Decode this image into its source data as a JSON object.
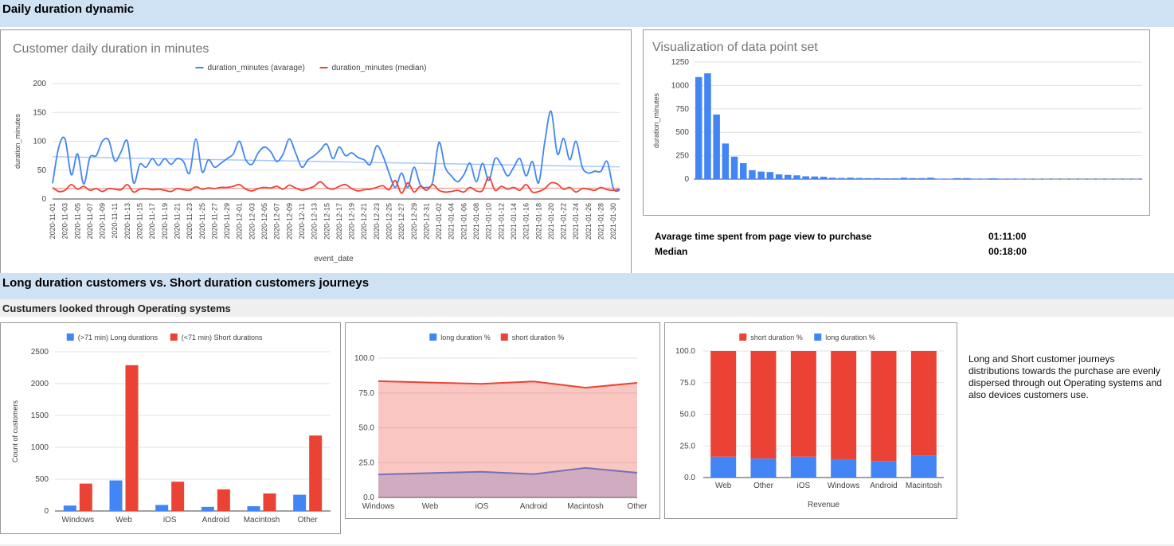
{
  "sections": {
    "daily_header": "Daily duration dynamic",
    "journeys_header": "Long duration customers vs. Short duration customers journeys",
    "os_subheader": "Custumers looked through Operating systems"
  },
  "summary": {
    "avg_label": "Avarage time spent from page view to purchase",
    "avg_value": "01:11:00",
    "median_label": "Median",
    "median_value": "00:18:00"
  },
  "note": "Long and Short customer journeys distributions towards the purchase are evenly dispersed through out Operating systems and also devices customers use.",
  "colors": {
    "blue": "#4285f4",
    "red": "#ea4335",
    "trend_blue": "#a8c7fa",
    "trend_red": "#f4a9a2",
    "grid": "#e0e0e0",
    "axis": "#444444"
  },
  "chart_data": [
    {
      "id": "daily",
      "type": "line",
      "title": "Customer daily duration in minutes",
      "xlabel": "event_date",
      "ylabel": "duration_minutes",
      "ylim": [
        0,
        200
      ],
      "yticks": [
        0,
        50,
        100,
        150,
        200
      ],
      "grid": true,
      "legend": "top",
      "trendlines": true,
      "x": [
        "2020-11-01",
        "2020-11-02",
        "2020-11-03",
        "2020-11-04",
        "2020-11-05",
        "2020-11-06",
        "2020-11-07",
        "2020-11-08",
        "2020-11-09",
        "2020-11-10",
        "2020-11-11",
        "2020-11-12",
        "2020-11-13",
        "2020-11-14",
        "2020-11-15",
        "2020-11-16",
        "2020-11-17",
        "2020-11-18",
        "2020-11-19",
        "2020-11-20",
        "2020-11-21",
        "2020-11-22",
        "2020-11-23",
        "2020-11-24",
        "2020-11-25",
        "2020-11-26",
        "2020-11-27",
        "2020-11-28",
        "2020-11-29",
        "2020-11-30",
        "2020-12-01",
        "2020-12-02",
        "2020-12-03",
        "2020-12-04",
        "2020-12-05",
        "2020-12-06",
        "2020-12-07",
        "2020-12-08",
        "2020-12-09",
        "2020-12-10",
        "2020-12-11",
        "2020-12-12",
        "2020-12-13",
        "2020-12-14",
        "2020-12-15",
        "2020-12-16",
        "2020-12-17",
        "2020-12-18",
        "2020-12-19",
        "2020-12-20",
        "2020-12-21",
        "2020-12-22",
        "2020-12-23",
        "2020-12-24",
        "2020-12-25",
        "2020-12-26",
        "2020-12-27",
        "2020-12-28",
        "2020-12-29",
        "2020-12-30",
        "2020-12-31",
        "2021-01-01",
        "2021-01-02",
        "2021-01-03",
        "2021-01-04",
        "2021-01-05",
        "2021-01-06",
        "2021-01-07",
        "2021-01-08",
        "2021-01-09",
        "2021-01-10",
        "2021-01-11",
        "2021-01-12",
        "2021-01-13",
        "2021-01-14",
        "2021-01-15",
        "2021-01-16",
        "2021-01-17",
        "2021-01-18",
        "2021-01-19",
        "2021-01-20",
        "2021-01-21",
        "2021-01-22",
        "2021-01-23",
        "2021-01-24",
        "2021-01-25",
        "2021-01-26",
        "2021-01-27",
        "2021-01-28",
        "2021-01-29",
        "2021-01-30",
        "2021-01-31"
      ],
      "xticks": [
        "2020-11-01",
        "2020-11-03",
        "2020-11-05",
        "2020-11-07",
        "2020-11-09",
        "2020-11-11",
        "2020-11-13",
        "2020-11-15",
        "2020-11-17",
        "2020-11-19",
        "2020-11-21",
        "2020-11-23",
        "2020-11-25",
        "2020-11-27",
        "2020-11-29",
        "2020-12-01",
        "2020-12-03",
        "2020-12-05",
        "2020-12-07",
        "2020-12-09",
        "2020-12-11",
        "2020-12-13",
        "2020-12-15",
        "2020-12-17",
        "2020-12-19",
        "2020-12-21",
        "2020-12-23",
        "2020-12-25",
        "2020-12-27",
        "2020-12-29",
        "2020-12-31",
        "2021-01-02",
        "2021-01-04",
        "2021-01-06",
        "2021-01-08",
        "2021-01-10",
        "2021-01-12",
        "2021-01-14",
        "2021-01-16",
        "2021-01-18",
        "2021-01-20",
        "2021-01-22",
        "2021-01-24",
        "2021-01-26",
        "2021-01-28",
        "2021-01-30"
      ],
      "series": [
        {
          "name": "duration_minutes (avarage)",
          "color": "#4285f4",
          "values": [
            27,
            90,
            104,
            42,
            78,
            26,
            72,
            75,
            100,
            102,
            66,
            82,
            100,
            28,
            60,
            55,
            70,
            58,
            70,
            60,
            70,
            65,
            45,
            104,
            47,
            68,
            55,
            62,
            70,
            78,
            100,
            68,
            60,
            80,
            90,
            82,
            65,
            78,
            104,
            80,
            55,
            68,
            75,
            85,
            95,
            70,
            90,
            75,
            80,
            72,
            68,
            60,
            92,
            75,
            45,
            20,
            45,
            20,
            55,
            25,
            20,
            30,
            98,
            55,
            40,
            30,
            42,
            62,
            30,
            62,
            32,
            70,
            60,
            40,
            55,
            70,
            40,
            65,
            28,
            100,
            152,
            78,
            105,
            68,
            100,
            55,
            45,
            48,
            48,
            65,
            18,
            15
          ]
        },
        {
          "name": "duration_minutes (median)",
          "color": "#ea4335",
          "values": [
            20,
            13,
            15,
            25,
            17,
            22,
            15,
            18,
            13,
            18,
            17,
            16,
            25,
            12,
            17,
            18,
            16,
            17,
            15,
            13,
            18,
            16,
            15,
            21,
            17,
            19,
            18,
            20,
            20,
            22,
            25,
            17,
            14,
            18,
            20,
            19,
            22,
            17,
            24,
            19,
            15,
            18,
            22,
            30,
            20,
            17,
            22,
            25,
            18,
            14,
            16,
            17,
            20,
            23,
            16,
            32,
            10,
            28,
            12,
            22,
            15,
            25,
            15,
            12,
            13,
            15,
            12,
            20,
            14,
            15,
            38,
            15,
            22,
            17,
            20,
            15,
            25,
            12,
            13,
            18,
            28,
            26,
            17,
            20,
            12,
            18,
            17,
            15,
            20,
            16,
            15,
            17
          ]
        }
      ]
    },
    {
      "id": "hist",
      "type": "bar",
      "title": "Visualization of data point set",
      "xlabel": "",
      "ylabel": "duration_minutes",
      "ylim": [
        0,
        1250
      ],
      "yticks": [
        0,
        250,
        500,
        750,
        1000,
        1250
      ],
      "grid": true,
      "values": [
        1090,
        1130,
        690,
        380,
        240,
        170,
        95,
        80,
        75,
        50,
        45,
        40,
        30,
        28,
        25,
        15,
        12,
        15,
        12,
        10,
        10,
        8,
        8,
        15,
        10,
        10,
        15,
        5,
        5,
        10,
        10,
        5,
        5,
        8,
        5,
        5,
        4,
        4,
        4,
        3,
        3,
        3,
        3,
        3,
        3,
        3,
        3,
        3,
        3,
        3,
        3,
        3,
        3,
        3,
        3,
        3
      ]
    },
    {
      "id": "os_counts",
      "type": "bar",
      "title": "",
      "xlabel": "",
      "ylabel": "Count of customers",
      "ylim": [
        0,
        2500
      ],
      "yticks": [
        0,
        500,
        1000,
        1500,
        2000,
        2500
      ],
      "grid": true,
      "legend": "top",
      "categories": [
        "Windows",
        "Web",
        "iOS",
        "Android",
        "Macintosh",
        "Other"
      ],
      "series": [
        {
          "name": "(>71 min) Long durations",
          "color": "#4285f4",
          "values": [
            85,
            480,
            95,
            65,
            75,
            255
          ]
        },
        {
          "name": "(<71 min) Short durations",
          "color": "#ea4335",
          "values": [
            430,
            2290,
            460,
            340,
            275,
            1185
          ]
        }
      ]
    },
    {
      "id": "os_area",
      "type": "area",
      "title": "",
      "xlabel": "",
      "ylabel": "",
      "ylim": [
        0,
        100
      ],
      "yticks": [
        "0.0",
        "25.0",
        "50.0",
        "75.0",
        "100.0"
      ],
      "grid": true,
      "legend": "top",
      "categories": [
        "Windows",
        "Web",
        "iOS",
        "Android",
        "Macintosh",
        "Other"
      ],
      "series": [
        {
          "name": "long duration %",
          "color": "#4285f4",
          "values": [
            16.5,
            17.5,
            18.4,
            16.7,
            21.2,
            17.7
          ]
        },
        {
          "name": "short duration %",
          "color": "#ea4335",
          "values": [
            83.5,
            82.5,
            81.6,
            83.3,
            78.8,
            82.3
          ]
        }
      ]
    },
    {
      "id": "stacked",
      "type": "bar",
      "stacked": true,
      "title": "",
      "xlabel": "Revenue",
      "ylabel": "",
      "ylim": [
        0,
        100
      ],
      "yticks": [
        "0.0",
        "25.0",
        "50.0",
        "75.0",
        "100.0"
      ],
      "grid": true,
      "legend": "top",
      "categories": [
        "Web",
        "Other",
        "iOS",
        "Windows",
        "Android",
        "Macintosh"
      ],
      "series": [
        {
          "name": "short duration %",
          "color": "#ea4335",
          "values": [
            83.5,
            85.0,
            83.5,
            85.5,
            87.0,
            82.5
          ]
        },
        {
          "name": "long duration %",
          "color": "#4285f4",
          "values": [
            16.5,
            15.0,
            16.5,
            14.5,
            13.0,
            17.5
          ]
        }
      ]
    }
  ]
}
